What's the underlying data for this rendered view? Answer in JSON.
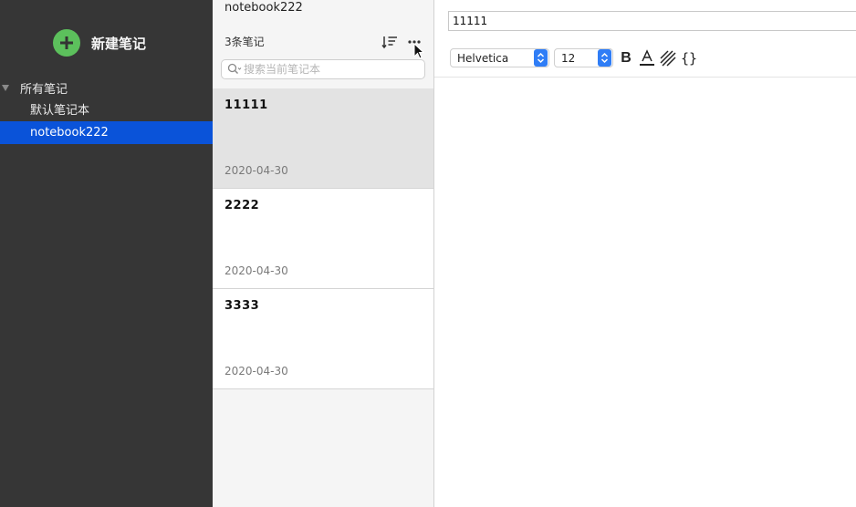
{
  "sidebar": {
    "new_note_label": "新建笔记",
    "all_notes_label": "所有笔记",
    "items": [
      {
        "label": "默认笔记本",
        "selected": false
      },
      {
        "label": "notebook222",
        "selected": true
      }
    ],
    "colors": {
      "background": "#363636",
      "selected": "#0a53d9",
      "accent": "#5cc05c"
    }
  },
  "list": {
    "notebook_title": "notebook222",
    "count_label": "3条笔记",
    "search_placeholder": "搜索当前笔记本",
    "icons": [
      "sort-icon",
      "more-icon",
      "search-icon"
    ],
    "notes": [
      {
        "title": "11111",
        "date": "2020-04-30",
        "active": true
      },
      {
        "title": "2222",
        "date": "2020-04-30",
        "active": false
      },
      {
        "title": "3333",
        "date": "2020-04-30",
        "active": false
      }
    ]
  },
  "editor": {
    "title_value": "11111",
    "font_name": "Helvetica",
    "font_size": "12",
    "bold_label": "B",
    "code_label": "{}",
    "content": ""
  }
}
